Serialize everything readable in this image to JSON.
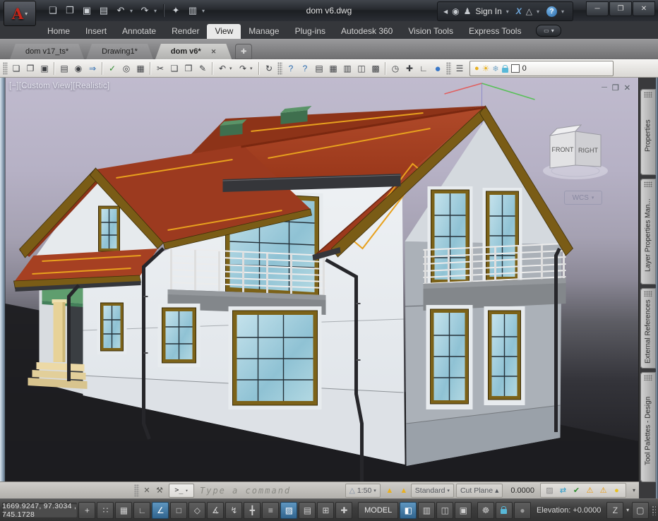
{
  "colors": {
    "roof": "#a64022",
    "roof_dark": "#8d3318",
    "wing": "#9c3a1f",
    "fascia": "#7a5c16",
    "trim": "#e8a11e",
    "wall": "#e9edf0",
    "wall_shade": "#abb1b8",
    "gable": "#d4d9de",
    "frame": "#7c6218",
    "glass": "#a9d5e2",
    "canopy": "#5f9e6e",
    "column": "#e7d298",
    "step": "#ecd9a6",
    "slab": "#83878b",
    "railing": "#ececec",
    "gutter": "#35363a",
    "pipe": "#26262a",
    "chimney": "#4a7a58",
    "ground": "#1c1c20",
    "active_toggle": "#31648e"
  },
  "ui": {
    "caret": "▾",
    "close": "✕",
    "minimize": "─",
    "restore": "❐",
    "plus": "✚"
  },
  "titlebar": {
    "title": "dom v6.dwg",
    "logo_letter": "A",
    "qat": [
      {
        "name": "new",
        "glyph": "❏"
      },
      {
        "name": "open",
        "glyph": "❐"
      },
      {
        "name": "save",
        "glyph": "▣"
      },
      {
        "name": "plot",
        "glyph": "▤"
      },
      {
        "name": "undo",
        "glyph": "↶"
      },
      {
        "name": "redo",
        "glyph": "↷"
      },
      {
        "name": "workspace",
        "glyph": "✦"
      },
      {
        "name": "properties-palette",
        "glyph": "▥"
      }
    ],
    "search_back_glyph": "◂",
    "search_glyph": "◉",
    "user_glyph": "♟",
    "signin_label": "Sign In",
    "exchange_glyph": "X",
    "a360_glyph": "△",
    "help_glyph": "?"
  },
  "ribbon": {
    "tabs": [
      "Home",
      "Insert",
      "Annotate",
      "Render",
      "View",
      "Manage",
      "Plug-ins",
      "Autodesk 360",
      "Vision Tools",
      "Express Tools"
    ],
    "active_tab": "View",
    "overflow_glyph": "▭"
  },
  "file_tabs": {
    "tabs": [
      "dom v17_ts*",
      "Drawing1*",
      "dom v6*"
    ],
    "active_tab": "dom v6*"
  },
  "toolbar": {
    "icons": [
      {
        "name": "new",
        "glyph": "❏"
      },
      {
        "name": "open",
        "glyph": "❐"
      },
      {
        "name": "save",
        "glyph": "▣"
      },
      {
        "name": "plot",
        "glyph": "▤"
      },
      {
        "name": "plot-preview",
        "glyph": "◉"
      },
      {
        "name": "publish",
        "glyph": "⇒"
      },
      {
        "name": "spell-check",
        "glyph": "✓"
      },
      {
        "name": "find",
        "glyph": "◎"
      },
      {
        "name": "quick-calc",
        "glyph": "▦"
      },
      {
        "name": "cut",
        "glyph": "✂"
      },
      {
        "name": "copy",
        "glyph": "❑"
      },
      {
        "name": "paste",
        "glyph": "❒"
      },
      {
        "name": "match-properties",
        "glyph": "✎"
      },
      {
        "name": "undo",
        "glyph": "↶"
      },
      {
        "name": "redo",
        "glyph": "↷"
      },
      {
        "name": "xref-refresh",
        "glyph": "↻"
      },
      {
        "name": "help",
        "glyph": "?"
      },
      {
        "name": "info-center",
        "glyph": "?"
      },
      {
        "name": "properties-palette",
        "glyph": "▤"
      },
      {
        "name": "design-center",
        "glyph": "▦"
      },
      {
        "name": "tool-palettes",
        "glyph": "▥"
      },
      {
        "name": "sheet-set-manager",
        "glyph": "◫"
      },
      {
        "name": "markup-set-manager",
        "glyph": "▩"
      },
      {
        "name": "time",
        "glyph": "◷"
      },
      {
        "name": "steering-wheel",
        "glyph": "✚"
      },
      {
        "name": "ucs-icon-toggle",
        "glyph": "∟"
      },
      {
        "name": "orbit",
        "glyph": "●"
      },
      {
        "name": "layer-properties-manager",
        "glyph": "☰"
      }
    ],
    "layer_controls": [
      {
        "name": "layer-on",
        "glyph": "●"
      },
      {
        "name": "layer-thaw",
        "glyph": "☀"
      },
      {
        "name": "layer-vp-freeze",
        "glyph": "❄"
      }
    ],
    "layer_name": "0"
  },
  "viewport": {
    "label": "[−][Custom View][Realistic]",
    "viewcube_front": "FRONT",
    "viewcube_right": "RIGHT",
    "wcs_label": "WCS"
  },
  "side_panels": [
    {
      "label": "Properties"
    },
    {
      "label": "Layer Properties Man..."
    },
    {
      "label": "External References"
    },
    {
      "label": "Tool Palettes - Design"
    }
  ],
  "command_line": {
    "customize_glyph": "⚒",
    "prompt_glyph": ">_",
    "placeholder": "Type a command",
    "annotation_glyph": "△",
    "scale_value": "1:50",
    "ann_visibility_glyph": "▲",
    "ann_autoscale_glyph": "▲",
    "style_value": "Standard",
    "cut_plane_label": "Cut Plane",
    "cut_plane_arrow": "▴",
    "field_value": "0.0000",
    "tray": [
      {
        "name": "hatch-background",
        "glyph": "▨"
      },
      {
        "name": "annotation-sync",
        "glyph": "⇄"
      },
      {
        "name": "plot-ok",
        "glyph": "✔"
      },
      {
        "name": "standards-warning",
        "glyph": "⚠"
      },
      {
        "name": "unreconciled-layers",
        "glyph": "⚠"
      },
      {
        "name": "tray-bulb",
        "glyph": "●"
      }
    ]
  },
  "status_bar": {
    "coordinates": "1669.9247,  97.3034 , 745.1728",
    "toggles": [
      {
        "name": "infer-constraints",
        "glyph": "+",
        "active": false
      },
      {
        "name": "snap-mode",
        "glyph": "∷",
        "active": false
      },
      {
        "name": "grid-display",
        "glyph": "▦",
        "active": false
      },
      {
        "name": "ortho-mode",
        "glyph": "∟",
        "active": false
      },
      {
        "name": "polar-tracking",
        "glyph": "∠",
        "active": true
      },
      {
        "name": "object-snap",
        "glyph": "□",
        "active": false
      },
      {
        "name": "3d-object-snap",
        "glyph": "◇",
        "active": false
      },
      {
        "name": "object-snap-tracking",
        "glyph": "∡",
        "active": false
      },
      {
        "name": "dynamic-ucs",
        "glyph": "↯",
        "active": false
      },
      {
        "name": "dynamic-input",
        "glyph": "╋",
        "active": false
      },
      {
        "name": "lineweight",
        "glyph": "≡",
        "active": false
      },
      {
        "name": "transparency",
        "glyph": "▨",
        "active": true
      },
      {
        "name": "quick-properties",
        "glyph": "▤",
        "active": false
      },
      {
        "name": "selection-cycling",
        "glyph": "⊞",
        "active": false
      },
      {
        "name": "annotation-monitor",
        "glyph": "✚",
        "active": false
      }
    ],
    "model_label": "MODEL",
    "layout_buttons": [
      {
        "name": "model-space",
        "glyph": "◧",
        "active": true
      },
      {
        "name": "quick-view-drawings",
        "glyph": "▥",
        "active": false
      },
      {
        "name": "quick-view-layouts",
        "glyph": "◫",
        "active": false
      },
      {
        "name": "dual-display",
        "glyph": "▣",
        "active": false
      }
    ],
    "gear_glyph": "☸",
    "circle_glyph": "●",
    "elevation_label": "Elevation:",
    "elevation_value": "+0.0000",
    "zoom_object_glyph": "Z",
    "clean_screen_glyph": "▢"
  }
}
